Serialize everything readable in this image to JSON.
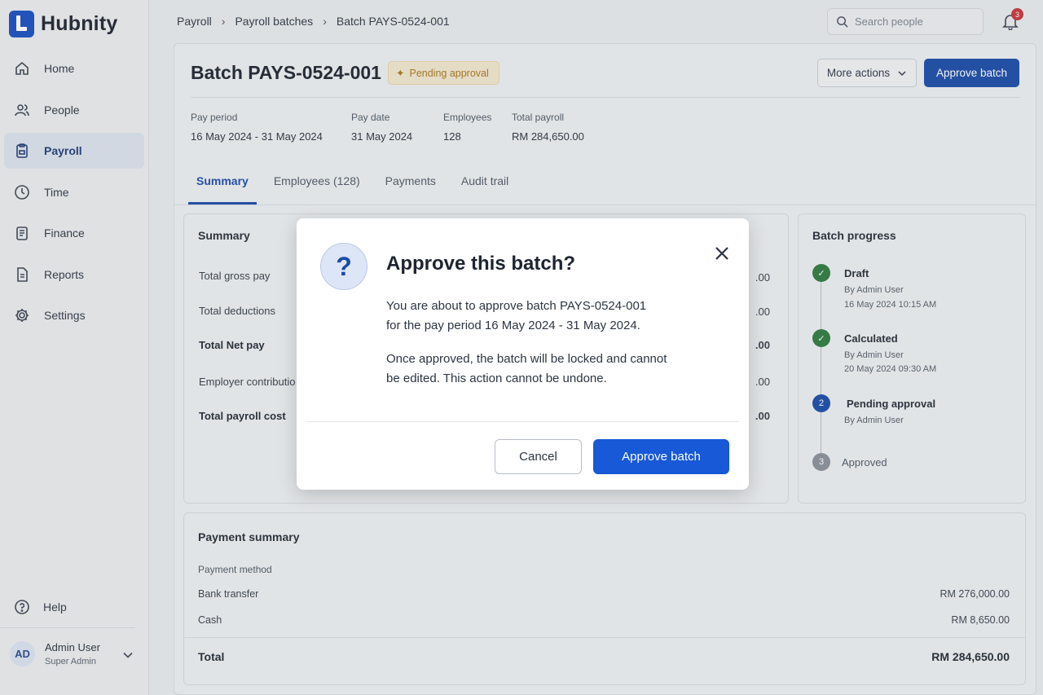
{
  "app": {
    "name": "Hubnity"
  },
  "sidebar": {
    "items": [
      {
        "label": "Home",
        "icon": "home-icon"
      },
      {
        "label": "People",
        "icon": "people-icon"
      },
      {
        "label": "Payroll",
        "icon": "payroll-icon",
        "active": true
      },
      {
        "label": "Time",
        "icon": "clock-icon"
      },
      {
        "label": "Finance",
        "icon": "finance-icon"
      },
      {
        "label": "Reports",
        "icon": "reports-icon"
      },
      {
        "label": "Settings",
        "icon": "gear-icon"
      }
    ],
    "help": "Help",
    "user": {
      "initials": "AD",
      "name": "Admin User",
      "role": "Super Admin"
    }
  },
  "breadcrumb": [
    "Payroll",
    "Payroll batches",
    "Batch PAYS-0524-001"
  ],
  "search": {
    "placeholder": "Search people"
  },
  "notifications": {
    "count": "3"
  },
  "header": {
    "title": "Batch PAYS-0524-001",
    "status": "Pending approval",
    "more_actions": "More actions",
    "approve": "Approve batch"
  },
  "meta": {
    "pay_period_label": "Pay period",
    "pay_period": "16 May 2024 - 31 May 2024",
    "pay_date_label": "Pay date",
    "pay_date": "31 May 2024",
    "employees_label": "Employees",
    "employees": "128",
    "total_label": "Total payroll",
    "total": "RM 284,650.00"
  },
  "tabs": [
    "Summary",
    "Employees (128)",
    "Payments",
    "Audit trail"
  ],
  "summary": {
    "title": "Summary",
    "rows": [
      {
        "label": "Total gross pay",
        "value": ".00"
      },
      {
        "label": "Total deductions",
        "value": ".00"
      },
      {
        "label": "Total Net pay",
        "value": ".00"
      },
      {
        "label": "Employer contributio",
        "value": ".00"
      },
      {
        "label": "Total payroll cost",
        "value": ".00"
      }
    ]
  },
  "progress": {
    "title": "Batch progress",
    "steps": [
      {
        "title": "Draft",
        "by": "By Admin User",
        "when": "16 May 2024  10:15 AM"
      },
      {
        "title": "Calculated",
        "by": "By Admin User",
        "when": "20 May 2024  09:30 AM"
      },
      {
        "title": "Pending approval",
        "number": "2",
        "by": "By Admin User"
      },
      {
        "title": "Approved",
        "number": "3"
      }
    ]
  },
  "payment_summary": {
    "title": "Payment summary",
    "method_label": "Payment method",
    "rows": [
      {
        "label": "Bank transfer",
        "value": "RM 276,000.00"
      },
      {
        "label": "Cash",
        "value": "RM 8,650.00"
      }
    ],
    "total_label": "Total",
    "total_value": "RM 284,650.00"
  },
  "dialog": {
    "icon_glyph": "?",
    "title": "Approve this batch?",
    "p1_line1": "You are about to approve batch PAYS-0524-001",
    "p1_line2": "for the pay period 16 May 2024 - 31 May 2024.",
    "p2_line1": "Once approved, the batch will be locked and cannot",
    "p2_line2": "be edited. This action cannot be undone.",
    "cancel": "Cancel",
    "confirm": "Approve batch"
  },
  "colors": {
    "primary": "#1b4ba8",
    "dialog_button": "#1759d6",
    "success": "#2f7a3f",
    "warning_bg": "#f2e7cf",
    "warning_text": "#a67720"
  }
}
